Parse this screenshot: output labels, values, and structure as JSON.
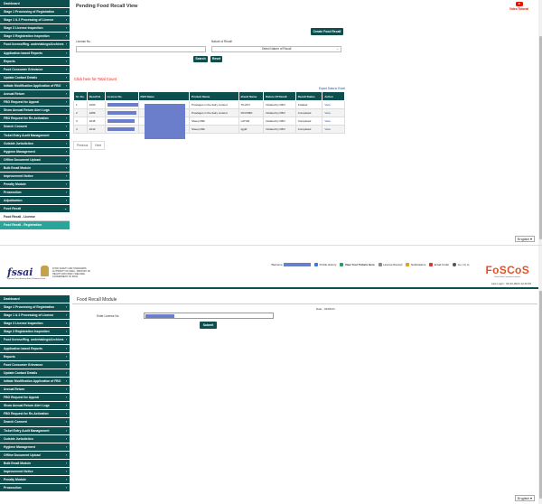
{
  "top": {
    "sidebar": [
      {
        "label": "Dashboard",
        "chev": ""
      },
      {
        "label": "Stage 1 Processing of Registration",
        "chev": "›"
      },
      {
        "label": "Stage 1 & 2 Processing of Licence",
        "chev": "›"
      },
      {
        "label": "Stage 3 License Inspection",
        "chev": "›"
      },
      {
        "label": "Stage 3 Registration Inspection",
        "chev": "›"
      },
      {
        "label": "Food license/Reg. undertakings/Archives",
        "chev": "›"
      },
      {
        "label": "Application based Reports",
        "chev": "›"
      },
      {
        "label": "Reports",
        "chev": "›"
      },
      {
        "label": "Food Consumer Grievance",
        "chev": "›"
      },
      {
        "label": "Update Contact Details",
        "chev": "›"
      },
      {
        "label": "Initiate Modification Application of FBO",
        "chev": "›"
      },
      {
        "label": "Annual Return",
        "chev": "›"
      },
      {
        "label": "FBO Request for Appeal",
        "chev": "›"
      },
      {
        "label": "Show Annual Return Alert Logs",
        "chev": "›"
      },
      {
        "label": "FBO Request for Re-Activation",
        "chev": "›"
      },
      {
        "label": "Search Consent",
        "chev": "›"
      },
      {
        "label": "Ticket Entry Audit Management",
        "chev": "›"
      },
      {
        "label": "Outside Jurisdiction",
        "chev": "›"
      },
      {
        "label": "Hygiene Management",
        "chev": "›"
      },
      {
        "label": "Offline Document Upload",
        "chev": "›"
      },
      {
        "label": "Bulk Email Module",
        "chev": "›"
      },
      {
        "label": "Improvement Notice",
        "chev": "›"
      },
      {
        "label": "Penalty Module",
        "chev": "›"
      },
      {
        "label": "Prosecution",
        "chev": "›"
      },
      {
        "label": "Adjudication",
        "chev": "›"
      },
      {
        "label": "Food Recall",
        "chev": "⌄"
      }
    ],
    "sub_items": [
      "Food Recall - License",
      "Food Recall - Registration"
    ],
    "title": "Pending Food Recall View",
    "video_tutorial": "Video Tutorial",
    "create_btn": "Create Food Recall",
    "license_label": "License No.",
    "nature_label": "Nature of Recall",
    "nature_value": "Select Nature of Recall",
    "search_btn": "Search",
    "reset_btn": "Reset",
    "total_link": "Click here for Total Count",
    "export": "Export Data to Excel",
    "columns": [
      "Sr. No.",
      "Recall Id",
      "License No.",
      "FBO Name",
      "Product Name",
      "Brand Name",
      "Nature Of Recall",
      "Recall Status",
      "Action"
    ],
    "rows": [
      {
        "sr": "1",
        "id": "2290",
        "product": "Prostagus in the dairy content",
        "brand": "TILATO",
        "nature": "Initiated by FBO",
        "status": "Initiated",
        "action": "View"
      },
      {
        "sr": "2",
        "id": "2289",
        "product": "Prostagus in the dairy content",
        "brand": "RCC5MD",
        "nature": "Initiated by FBO",
        "status": "Completed",
        "action": "View"
      },
      {
        "sr": "3",
        "id": "2245",
        "product": "Sheep Milk",
        "brand": "LATUR",
        "nature": "Initiated by FBO",
        "status": "Completed",
        "action": "View"
      },
      {
        "sr": "4",
        "id": "2243",
        "product": "Sheep Milk",
        "brand": "tggfd",
        "nature": "Initiated by FBO",
        "status": "Completed",
        "action": "View"
      }
    ],
    "pager": [
      "Previous",
      "Next"
    ],
    "language": "English ▾"
  },
  "bottom": {
    "brand_fssai": "fssai",
    "brand_sub": "Inspiring Trust, Assuring Safe & Nutritious Food",
    "gov_text": "FOOD SAFETY AND STANDARDS AUTHORITY OF INDIA · MINISTRY OF HEALTH AND FAMILY WELFARE, GOVERNMENT OF INDIA",
    "topnav": {
      "welcome": "Welcome",
      "profile": "Profile History",
      "view_tickets": "View Your Tickets Here",
      "lens": "License Receipt",
      "notifications": "Notifications",
      "email": "Email Under",
      "font": "A+ | A | A-"
    },
    "foscos": "FoSCoS",
    "foscos_sub": "Food Safety Compliance System",
    "last_login": "Last Login : 04-03-2024 12:43:46",
    "sidebar": [
      "Dashboard",
      "Stage 1 Processing of Registration",
      "Stage 1 & 2 Processing of Licence",
      "Stage 3 License Inspection",
      "Stage 3 Registration Inspection",
      "Food license/Reg. undertakings/Archives",
      "Application based Reports",
      "Reports",
      "Food Consumer Grievance",
      "Update Contact Details",
      "Initiate Modification Application of FBO",
      "Annual Return",
      "FBO Request for Appeal",
      "Show Annual Return Alert Logs",
      "FBO Request for Re-Activation",
      "Search Consent",
      "Ticket Entry Audit Management",
      "Outside Jurisdiction",
      "Hygiene Management",
      "Offline Document Upload",
      "Bulk Email Module",
      "Improvement Notice",
      "Penalty Module",
      "Prosecution"
    ],
    "title": "Food Recall Module",
    "date": "Date : 04/03/24",
    "license_label": "Enter License No.",
    "submit_btn": "Submit",
    "language": "English ▾"
  }
}
